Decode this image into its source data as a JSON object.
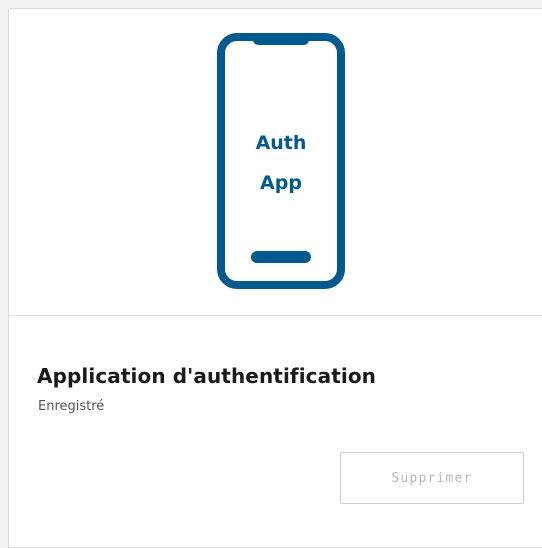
{
  "card": {
    "illustration": {
      "line1": "Auth",
      "line2": "App",
      "accent_color": "#005a8e"
    },
    "title": "Application d'authentification",
    "status": "Enregistré",
    "delete_label": "Supprimer"
  }
}
